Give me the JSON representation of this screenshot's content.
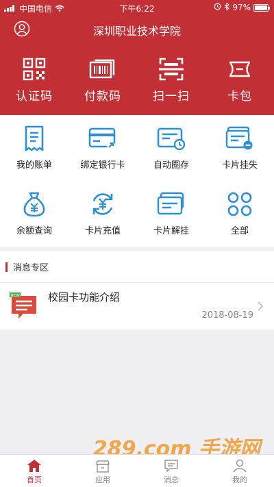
{
  "status_bar": {
    "carrier": "中国电信",
    "time": "下午6:22",
    "battery": "97%"
  },
  "header": {
    "title": "深圳职业技术学院"
  },
  "quick_actions": [
    {
      "label": "认证码",
      "icon": "qrcode-icon"
    },
    {
      "label": "付款码",
      "icon": "barcode-icon"
    },
    {
      "label": "扫一扫",
      "icon": "scan-icon"
    },
    {
      "label": "卡包",
      "icon": "ticket-icon"
    }
  ],
  "grid_items": [
    {
      "label": "我的账单",
      "icon": "bill-icon"
    },
    {
      "label": "绑定银行卡",
      "icon": "bind-card-icon"
    },
    {
      "label": "自动圈存",
      "icon": "auto-load-icon"
    },
    {
      "label": "卡片挂失",
      "icon": "card-lost-icon"
    },
    {
      "label": "余额查询",
      "icon": "money-bag-icon"
    },
    {
      "label": "卡片充值",
      "icon": "recharge-icon"
    },
    {
      "label": "卡片解挂",
      "icon": "card-unlock-icon"
    },
    {
      "label": "全部",
      "icon": "all-apps-icon"
    }
  ],
  "news": {
    "section_title": "消息专区",
    "items": [
      {
        "title": "校园卡功能介绍",
        "date": "2018-08-19",
        "badge": "NEW"
      }
    ]
  },
  "watermark": "289.com 手游网",
  "tabbar": [
    {
      "label": "首页",
      "icon": "home-icon",
      "active": true
    },
    {
      "label": "应用",
      "icon": "apps-icon",
      "active": false
    },
    {
      "label": "消息",
      "icon": "message-icon",
      "active": false
    },
    {
      "label": "我的",
      "icon": "profile-icon",
      "active": false
    }
  ],
  "colors": {
    "brand": "#c22f35",
    "icon_blue": "#2d8fd6",
    "background": "#efeff4"
  }
}
